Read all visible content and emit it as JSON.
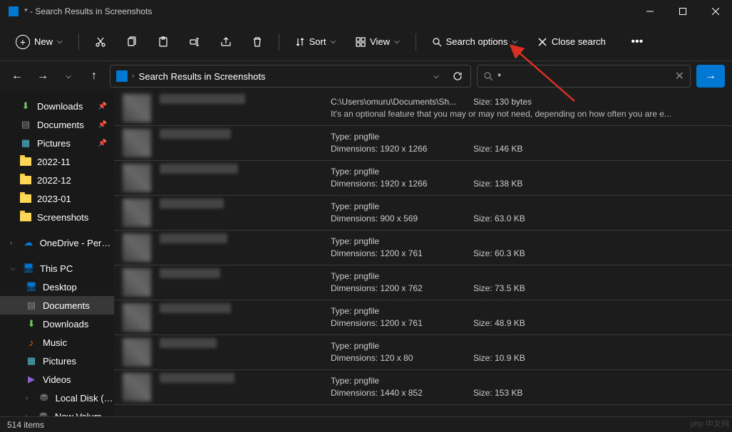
{
  "window": {
    "title": "* - Search Results in Screenshots"
  },
  "toolbar": {
    "new_label": "New",
    "sort_label": "Sort",
    "view_label": "View",
    "search_options_label": "Search options",
    "close_search_label": "Close search"
  },
  "address": {
    "text": "Search Results in Screenshots"
  },
  "search": {
    "value": "*"
  },
  "sidebar": {
    "items": [
      {
        "label": "Downloads",
        "icon": "download",
        "pinned": true
      },
      {
        "label": "Documents",
        "icon": "document",
        "pinned": true
      },
      {
        "label": "Pictures",
        "icon": "picture",
        "pinned": true
      },
      {
        "label": "2022-11",
        "icon": "folder"
      },
      {
        "label": "2022-12",
        "icon": "folder"
      },
      {
        "label": "2023-01",
        "icon": "folder"
      },
      {
        "label": "Screenshots",
        "icon": "folder"
      },
      {
        "label": "OneDrive - Person",
        "icon": "cloud",
        "prefix": ">"
      },
      {
        "label": "This PC",
        "icon": "pc",
        "prefix": "v"
      },
      {
        "label": "Desktop",
        "icon": "desktop",
        "indent": true
      },
      {
        "label": "Documents",
        "icon": "document",
        "indent": true,
        "active": true
      },
      {
        "label": "Downloads",
        "icon": "download",
        "indent": true
      },
      {
        "label": "Music",
        "icon": "music",
        "indent": true
      },
      {
        "label": "Pictures",
        "icon": "picture",
        "indent": true
      },
      {
        "label": "Videos",
        "icon": "video",
        "indent": true
      },
      {
        "label": "Local Disk (C:)",
        "icon": "disk",
        "indent": true,
        "prefix": ">"
      },
      {
        "label": "New Volume (D:",
        "icon": "disk",
        "indent": true,
        "prefix": ">"
      }
    ]
  },
  "results": [
    {
      "path": "C:\\Users\\omuru\\Documents\\Sh...",
      "size": "130 bytes",
      "desc": "It's an optional feature that you may or may not need, depending on how often you are e..."
    },
    {
      "type": "pngfile",
      "dimensions": "1920 x 1266",
      "size": "146 KB"
    },
    {
      "type": "pngfile",
      "dimensions": "1920 x 1266",
      "size": "138 KB"
    },
    {
      "type": "pngfile",
      "dimensions": "900 x 569",
      "size": "63.0 KB"
    },
    {
      "type": "pngfile",
      "dimensions": "1200 x 761",
      "size": "60.3 KB"
    },
    {
      "type": "pngfile",
      "dimensions": "1200 x 762",
      "size": "73.5 KB"
    },
    {
      "type": "pngfile",
      "dimensions": "1200 x 761",
      "size": "48.9 KB"
    },
    {
      "type": "pngfile",
      "dimensions": "120 x 80",
      "size": "10.9 KB"
    },
    {
      "type": "pngfile",
      "dimensions": "1440 x 852",
      "size": "153 KB"
    }
  ],
  "status": {
    "count": "514 items"
  },
  "labels": {
    "type": "Type:",
    "dimensions": "Dimensions:",
    "size": "Size:"
  }
}
